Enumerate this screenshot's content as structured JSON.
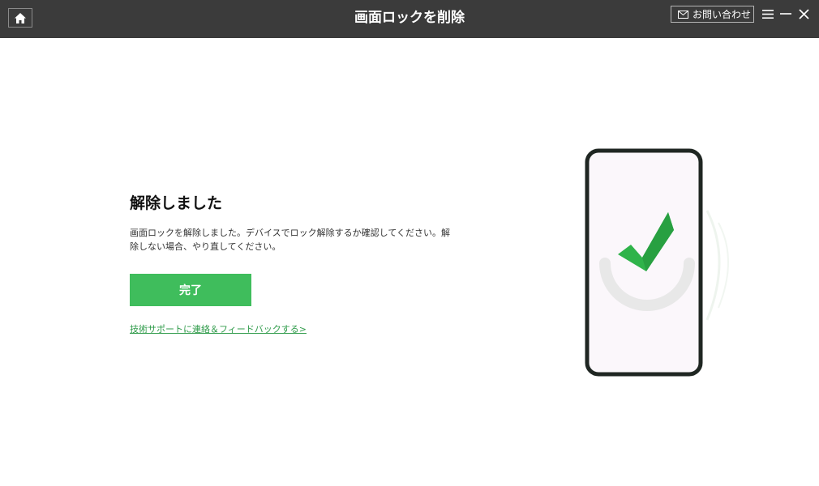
{
  "titlebar": {
    "title": "画面ロックを削除",
    "contact_label": "お問い合わせ",
    "icons": {
      "home": "home-icon",
      "mail": "mail-icon",
      "menu": "menu-icon",
      "minimize": "minimize-icon",
      "close": "close-icon"
    }
  },
  "main": {
    "title": "解除しました",
    "description": "画面ロックを解除しました。デバイスでロック解除するか確認してください。解除しない場合、やり直してください。",
    "done_button": "完了",
    "support_link": "技術サポートに連絡＆フィードバックする>"
  },
  "illustration": {
    "icon": "phone-checkmark-icon"
  },
  "colors": {
    "titlebar_bg": "#3b3b3b",
    "accent_green": "#3fbd5c",
    "link_green": "#2f9b4a",
    "phone_frame": "#1f2622"
  }
}
